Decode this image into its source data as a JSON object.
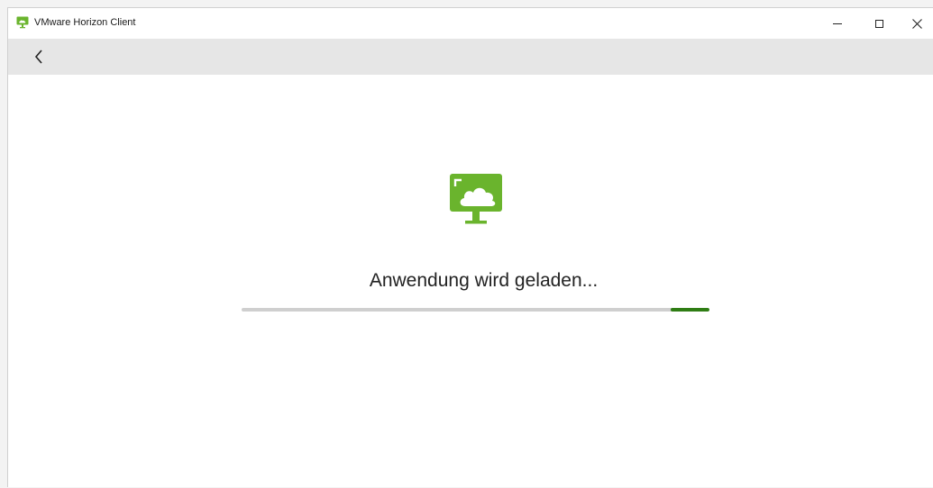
{
  "window": {
    "title": "VMware Horizon Client",
    "controls": {
      "minimize": "minimize",
      "maximize": "maximize",
      "close": "close"
    }
  },
  "toolbar": {
    "back_icon": "chevron-left-icon"
  },
  "main": {
    "icon": "desktop-cloud-icon",
    "status_text": "Anwendung wird geladen...",
    "progress": {
      "indeterminate": true,
      "segment_start": 0.917,
      "segment_width": 0.083
    }
  },
  "colors": {
    "brand_green": "#6ab42d",
    "progress_fill": "#2f7d14",
    "progress_track": "#cfcfcf",
    "toolbar_bg": "#e6e6e6"
  }
}
